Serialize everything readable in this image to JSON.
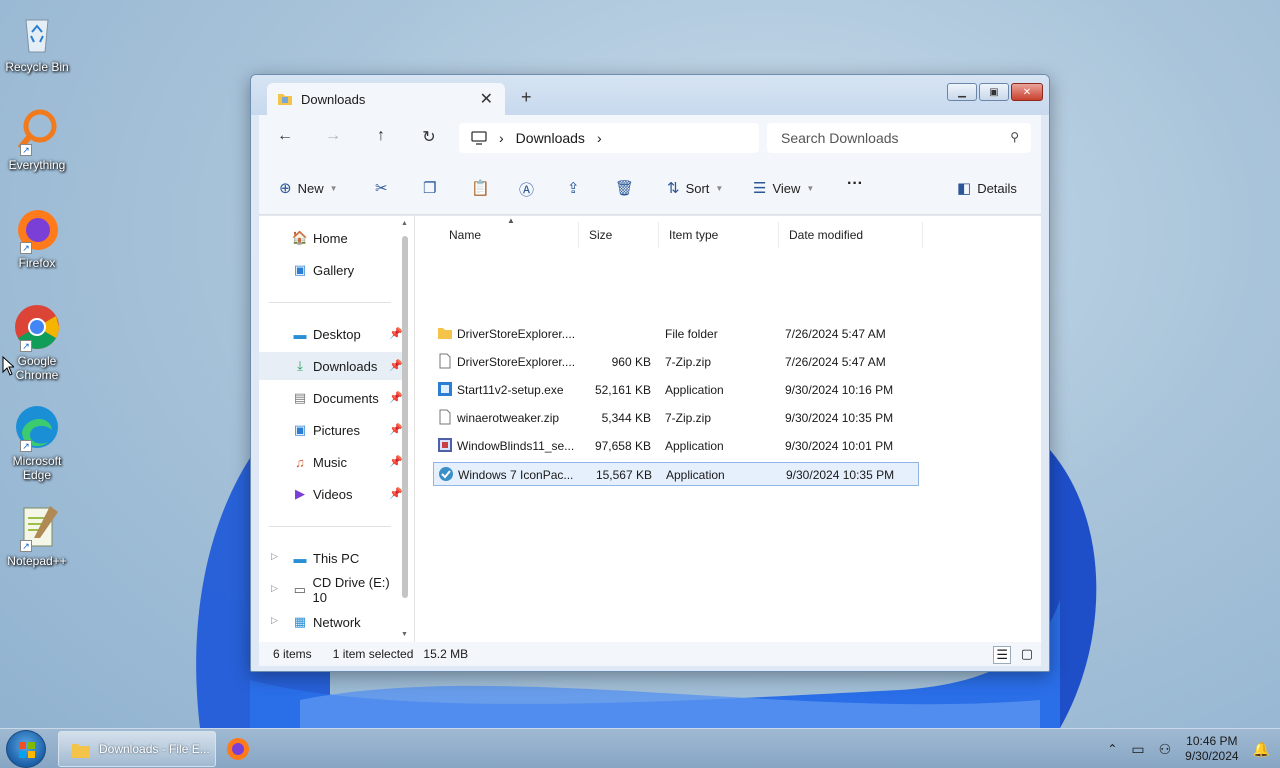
{
  "desktop": {
    "icons": [
      {
        "label": "Recycle Bin"
      },
      {
        "label": "Everything"
      },
      {
        "label": "Firefox"
      },
      {
        "label": "Google Chrome"
      },
      {
        "label": "Microsoft Edge"
      },
      {
        "label": "Notepad++"
      }
    ]
  },
  "window": {
    "tab_title": "Downloads",
    "address": {
      "location": "Downloads"
    },
    "search": {
      "placeholder": "Search Downloads"
    },
    "toolbar": {
      "new_label": "New",
      "sort_label": "Sort",
      "view_label": "View",
      "more_label": "···",
      "details_label": "Details"
    },
    "nav": {
      "items": [
        {
          "label": "Home"
        },
        {
          "label": "Gallery"
        },
        {
          "label": "Desktop"
        },
        {
          "label": "Downloads"
        },
        {
          "label": "Documents"
        },
        {
          "label": "Pictures"
        },
        {
          "label": "Music"
        },
        {
          "label": "Videos"
        },
        {
          "label": "This PC"
        },
        {
          "label": "CD Drive (E:) 10"
        },
        {
          "label": "Network"
        }
      ]
    },
    "columns": {
      "name": "Name",
      "size": "Size",
      "type": "Item type",
      "date": "Date modified"
    },
    "files": [
      {
        "name": "DriverStoreExplorer....",
        "size": "",
        "type": "File folder",
        "date": "7/26/2024 5:47 AM"
      },
      {
        "name": "DriverStoreExplorer....",
        "size": "960 KB",
        "type": "7-Zip.zip",
        "date": "7/26/2024 5:47 AM"
      },
      {
        "name": "Start11v2-setup.exe",
        "size": "52,161 KB",
        "type": "Application",
        "date": "9/30/2024 10:16 PM"
      },
      {
        "name": "winaerotweaker.zip",
        "size": "5,344 KB",
        "type": "7-Zip.zip",
        "date": "9/30/2024 10:35 PM"
      },
      {
        "name": "WindowBlinds11_se...",
        "size": "97,658 KB",
        "type": "Application",
        "date": "9/30/2024 10:01 PM"
      },
      {
        "name": "Windows 7 IconPac...",
        "size": "15,567 KB",
        "type": "Application",
        "date": "9/30/2024 10:35 PM"
      }
    ],
    "status": {
      "count": "6 items",
      "selected": "1 item selected",
      "size": "15.2 MB"
    }
  },
  "taskbar": {
    "task_label": "Downloads - File E...",
    "time": "10:46 PM",
    "date": "9/30/2024"
  }
}
